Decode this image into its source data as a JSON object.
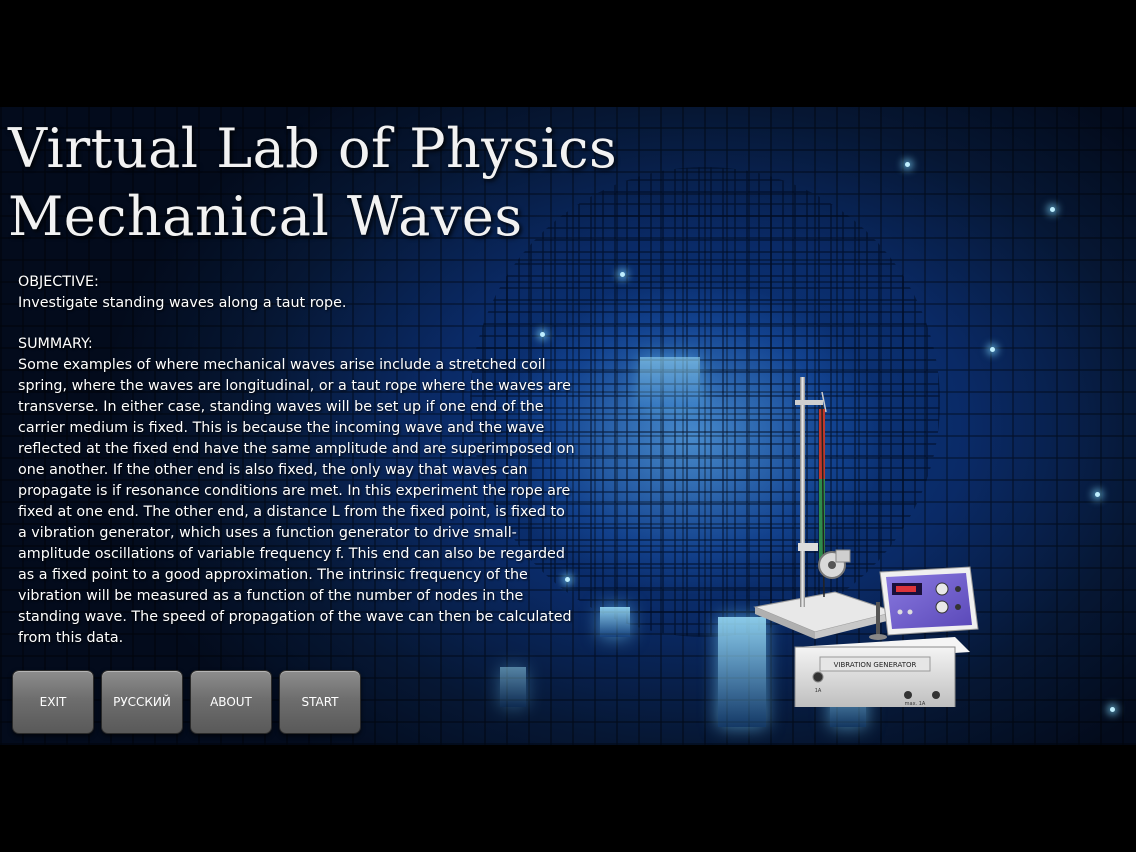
{
  "title_line1": "Virtual Lab of Physics",
  "title_line2": "Mechanical Waves",
  "objective": {
    "heading": "OBJECTIVE:",
    "text": "Investigate standing waves along a taut rope."
  },
  "summary": {
    "heading": "SUMMARY:",
    "text": "Some examples of where mechanical waves arise include a stretched coil spring, where the waves are longitudinal, or a taut rope where the waves are transverse. In either case, standing waves will be set up if one end of the carrier medium is fixed. This is because the incoming wave and the wave reflected at the fixed end have the same amplitude and are superimposed on one another. If the other end is also fixed, the only way that waves can propagate is if resonance conditions are met. In this experiment the rope are fixed at one end. The other end, a distance L from the fixed point, is fixed to a vibration generator, which uses a function generator to drive small-amplitude oscillations of variable frequency f. This end can also be regarded as a fixed point to a good approximation. The intrinsic frequency of the vibration will be measured as a function of the number of nodes in the standing wave. The speed of propagation of the wave can then be calculated from this data."
  },
  "buttons": {
    "exit": "EXIT",
    "russian": "РУССКИЙ",
    "about": "ABOUT",
    "start": "START"
  },
  "apparatus": {
    "generator_label": "VIBRATION GENERATOR",
    "input_label": "1A",
    "max_label": "max. 1A"
  },
  "colors": {
    "background": "#000000",
    "scene_blue": "#0d3f8e",
    "button_gray": "#6e6e6e",
    "text": "#ffffff"
  }
}
